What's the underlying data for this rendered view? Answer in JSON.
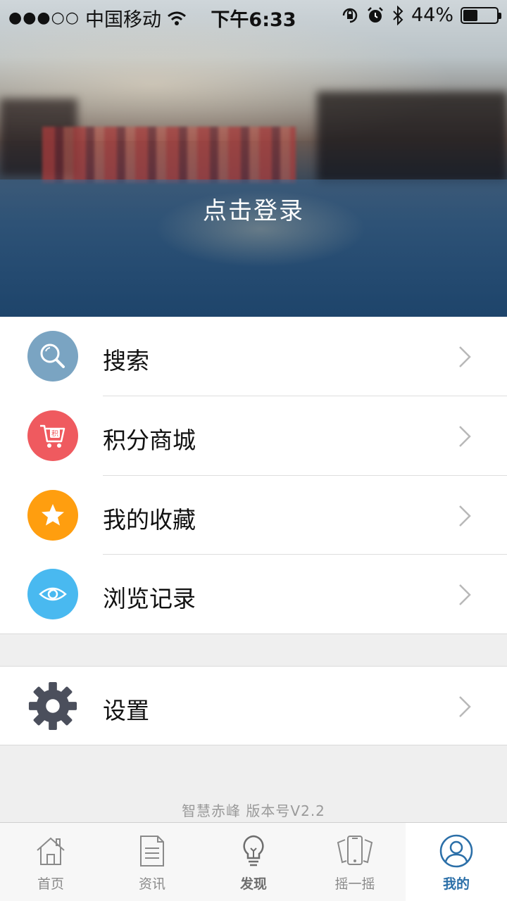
{
  "status_bar": {
    "signal": "●●●○○",
    "carrier": "中国移动",
    "time": "下午6:33",
    "battery_text": "44%",
    "battery_level": 0.44
  },
  "hero": {
    "login_text": "点击登录"
  },
  "menu": {
    "items": [
      {
        "label": "搜索",
        "icon": "search-icon",
        "color": "#7aa4c2"
      },
      {
        "label": "积分商城",
        "icon": "cart-icon",
        "color": "#ef5a5f",
        "badge": "积"
      },
      {
        "label": "我的收藏",
        "icon": "star-icon",
        "color": "#ff9e0f"
      },
      {
        "label": "浏览记录",
        "icon": "eye-icon",
        "color": "#49b9f0"
      }
    ],
    "settings": {
      "label": "设置",
      "icon": "gear-icon",
      "color": "#4b4f5c"
    }
  },
  "footer": {
    "version_text": "智慧赤峰  版本号V2.2"
  },
  "tabbar": {
    "tabs": [
      {
        "label": "首页",
        "icon": "home-icon"
      },
      {
        "label": "资讯",
        "icon": "news-icon"
      },
      {
        "label": "发现",
        "icon": "bulb-icon"
      },
      {
        "label": "摇一摇",
        "icon": "shake-icon"
      },
      {
        "label": "我的",
        "icon": "user-icon",
        "active": true
      }
    ],
    "active_color": "#2b6fa8"
  }
}
